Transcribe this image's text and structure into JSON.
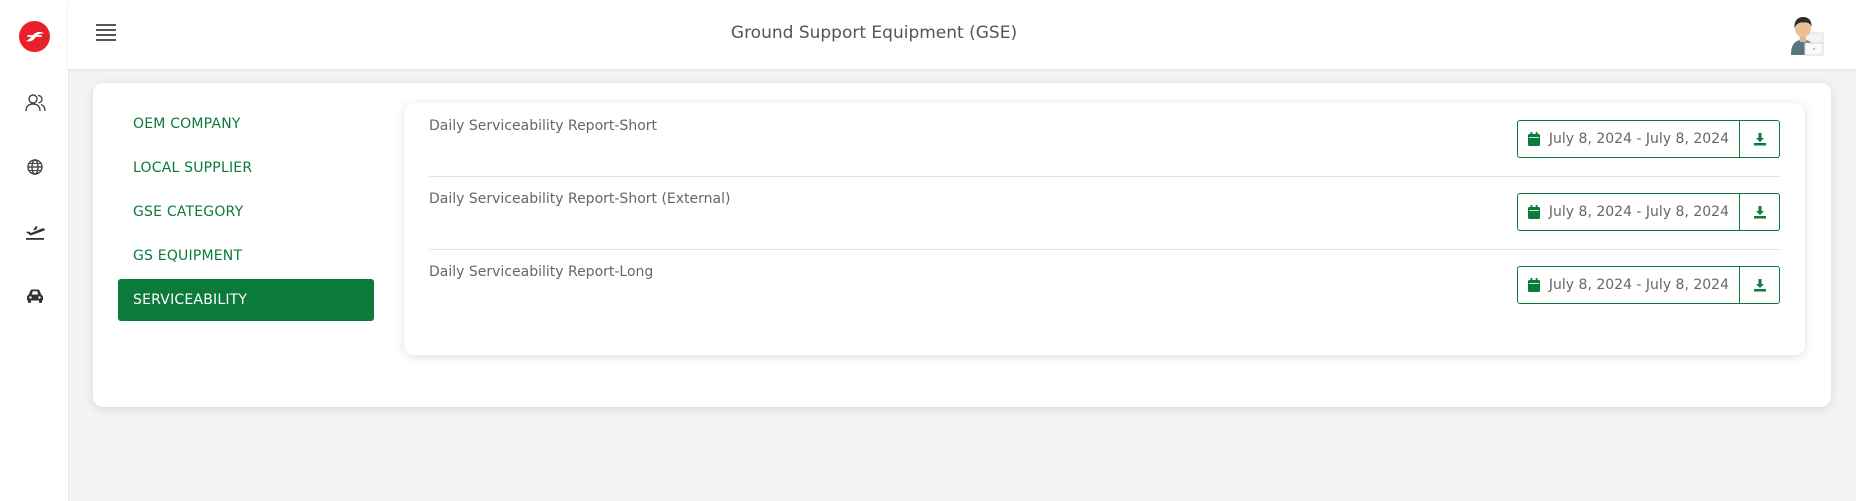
{
  "header": {
    "title": "Ground Support Equipment (GSE)"
  },
  "sidebar_icons": [
    "logo-icon",
    "users-icon",
    "globe-icon",
    "plane-departure-icon",
    "car-icon"
  ],
  "menu": {
    "items": [
      {
        "label": "OEM COMPANY",
        "active": false
      },
      {
        "label": "LOCAL SUPPLIER",
        "active": false
      },
      {
        "label": "GSE CATEGORY",
        "active": false
      },
      {
        "label": "GS EQUIPMENT",
        "active": false
      },
      {
        "label": "SERVICEABILITY",
        "active": true
      }
    ]
  },
  "reports": [
    {
      "name": "Daily Serviceability Report-Short",
      "date_range": "July 8, 2024 - July 8, 2024"
    },
    {
      "name": "Daily Serviceability Report-Short (External)",
      "date_range": "July 8, 2024 - July 8, 2024"
    },
    {
      "name": "Daily Serviceability Report-Long",
      "date_range": "July 8, 2024 - July 8, 2024"
    }
  ],
  "colors": {
    "accent": "#0b7a3b",
    "brand_red": "#e8202b",
    "text_muted": "#666666",
    "background": "#f4f4f4"
  }
}
